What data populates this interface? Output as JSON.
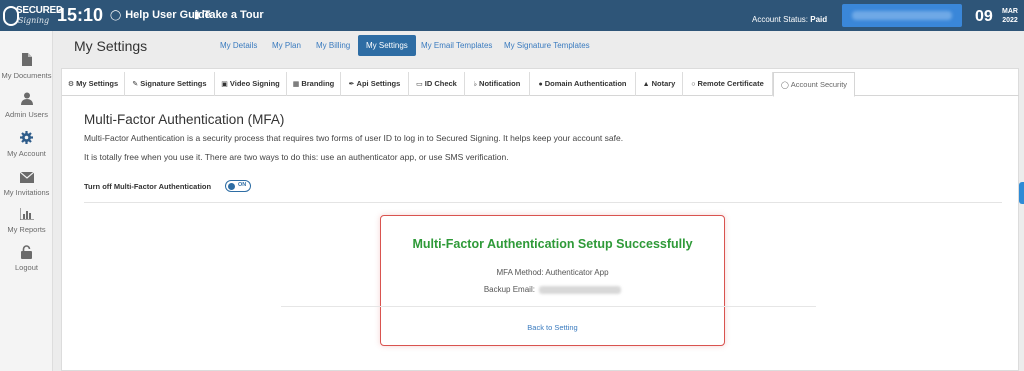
{
  "topbar": {
    "logo_top": "SECURED",
    "logo_script": "Signing",
    "time": "15:10",
    "help_link": "Help User Guide",
    "tour_link": "Take a Tour",
    "account_status_label": "Account Status:",
    "account_status_value": "Paid",
    "date_day": "09",
    "date_month": "MAR",
    "date_year": "2022"
  },
  "sidebar": {
    "items": [
      {
        "label": "My Documents",
        "icon": "document-icon"
      },
      {
        "label": "Admin Users",
        "icon": "user-icon"
      },
      {
        "label": "My Account",
        "icon": "gear-icon"
      },
      {
        "label": "My Invitations",
        "icon": "envelope-icon"
      },
      {
        "label": "My Reports",
        "icon": "bar-chart-icon"
      },
      {
        "label": "Logout",
        "icon": "lock-icon"
      }
    ]
  },
  "header": {
    "title": "My Settings",
    "tabs": [
      "My Details",
      "My Plan",
      "My Billing",
      "My Settings",
      "My Email Templates",
      "My Signature Templates"
    ],
    "active_tab": "My Settings"
  },
  "settings_tabs": [
    {
      "label": "My Settings",
      "icon": "gear-icon"
    },
    {
      "label": "Signature Settings",
      "icon": "pen-icon"
    },
    {
      "label": "Video Signing",
      "icon": "video-icon"
    },
    {
      "label": "Branding",
      "icon": "grid-icon"
    },
    {
      "label": "Api Settings",
      "icon": "wrench-icon"
    },
    {
      "label": "ID Check",
      "icon": "id-card-icon"
    },
    {
      "label": "Notification",
      "icon": "bell-icon"
    },
    {
      "label": "Domain Authentication",
      "icon": "globe-icon"
    },
    {
      "label": "Notary",
      "icon": "stamp-icon"
    },
    {
      "label": "Remote Certificate",
      "icon": "certificate-icon"
    },
    {
      "label": "Account Security",
      "icon": "shield-icon"
    }
  ],
  "active_settings_tab": "Account Security",
  "mfa": {
    "title": "Multi-Factor Authentication (MFA)",
    "description_1": "Multi-Factor Authentication is a security process that requires two forms of user ID to log in to Secured Signing. It helps keep your account safe.",
    "description_2": "It is totally free when you use it. There are two ways to do this: use an authenticator app, or use SMS verification.",
    "toggle_label": "Turn off Multi-Factor Authentication",
    "toggle_state": "ON"
  },
  "success_card": {
    "title": "Multi-Factor Authentication Setup Successfully",
    "method_label": "MFA Method:",
    "method_value": "Authenticator App",
    "backup_email_label": "Backup Email:",
    "back_link": "Back to Setting"
  },
  "colors": {
    "topbar": "#2e5578",
    "accent": "#2e6da4",
    "success": "#2e9a38",
    "card_border": "#d9534f"
  }
}
